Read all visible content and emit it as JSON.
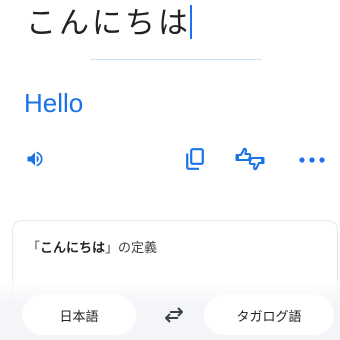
{
  "input": {
    "text": "こんにちは"
  },
  "output": {
    "translation": "Hello"
  },
  "actions": {
    "listen_icon": "speaker-icon",
    "copy_icon": "copy-icon",
    "feedback_icon": "thumbs-icon",
    "more_icon": "more-icon"
  },
  "definition": {
    "open_bracket": "「",
    "term": "こんにちは",
    "close_bracket": "」",
    "suffix": "の定義"
  },
  "languages": {
    "source": "日本語",
    "target": "タガログ語",
    "swap_icon": "swap-icon"
  },
  "colors": {
    "accent": "#1a73e8",
    "text": "#202124",
    "muted_bg": "#f3f5f8"
  }
}
